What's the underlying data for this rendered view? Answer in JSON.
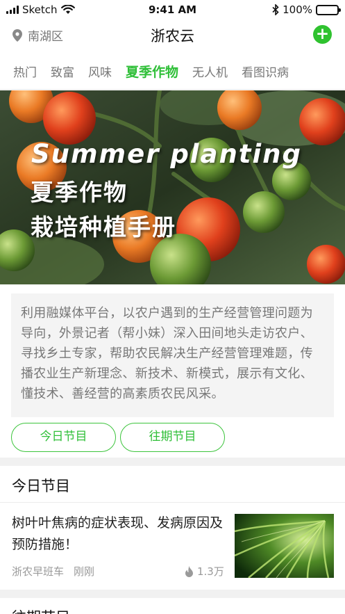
{
  "status_bar": {
    "carrier": "Sketch",
    "time": "9:41 AM",
    "battery": "100%",
    "battery_level": 1.0
  },
  "header": {
    "location": "南湖区",
    "title": "浙农云"
  },
  "tabs": [
    {
      "label": "热门"
    },
    {
      "label": "致富"
    },
    {
      "label": "风味"
    },
    {
      "label": "夏季作物",
      "active": true
    },
    {
      "label": "无人机"
    },
    {
      "label": "看图识病"
    }
  ],
  "banner": {
    "english": "Summer planting",
    "line1": "夏季作物",
    "line2": "栽培种植手册"
  },
  "description": "利用融媒体平台，以农户遇到的生产经营管理问题为导向，外景记者（帮小妹）深入田间地头走访农户、寻找乡土专家，帮助农民解决生产经营管理难题，传播农业生产新理念、新技术、新模式，展示有文化、懂技术、善经营的高素质农民风采。",
  "buttons": {
    "today": "今日节目",
    "past": "往期节目"
  },
  "today_section": {
    "title": "今日节目",
    "items": [
      {
        "title": "树叶叶焦病的症状表现、发病原因及预防措施！",
        "source": "浙农早班车",
        "time": "刚刚",
        "views": "1.3万"
      }
    ]
  },
  "past_section": {
    "title": "往期节目"
  },
  "colors": {
    "accent": "#2fbf38",
    "muted_text": "#777777",
    "panel_bg": "#f4f4f4"
  },
  "icons": {
    "location": "location-pin-icon",
    "add": "plus-circle-icon",
    "views": "flame-icon"
  }
}
